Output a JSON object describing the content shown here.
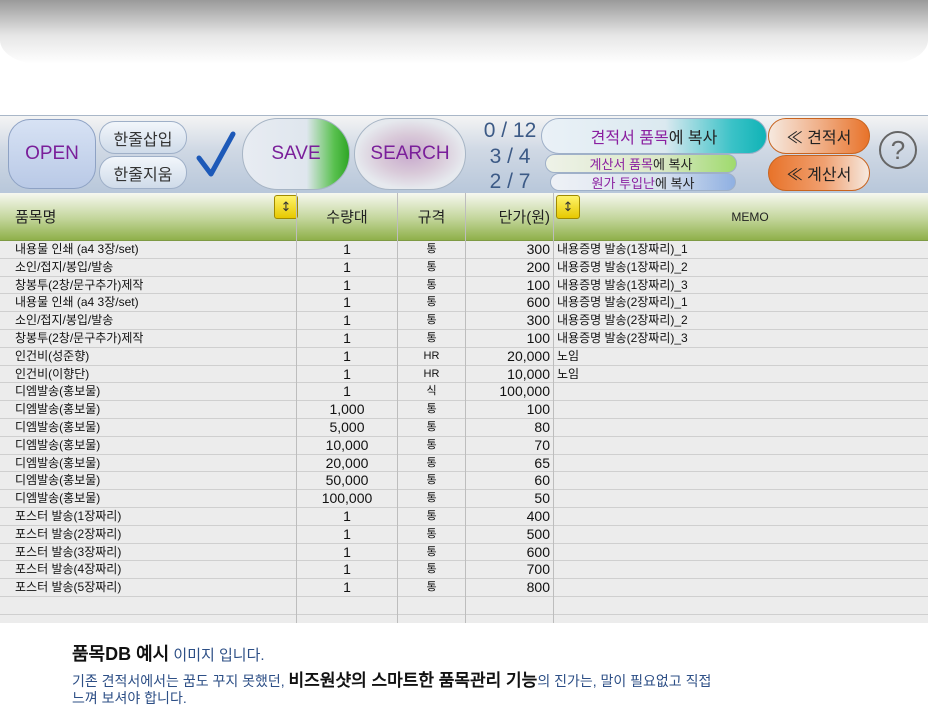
{
  "toolbar": {
    "open": "OPEN",
    "insert_row": "한줄삽입",
    "delete_row": "한줄지움",
    "save": "SAVE",
    "search": "SEARCH",
    "counters": [
      "0 / 12",
      "3 / 4",
      "2 / 7"
    ],
    "copy_quote_items_a": "견적서 품목",
    "copy_quote_items_b": "에 복사",
    "copy_bill_items_a": "계산서 품목",
    "copy_bill_items_b": "에 복사",
    "copy_cost_a": "원가 투입난",
    "copy_cost_b": "에 복사",
    "to_quote": "≪ 견적서",
    "to_bill": "≪ 계산서",
    "help": "?"
  },
  "table": {
    "headers": {
      "name": "품목명",
      "qty": "수량대",
      "unit": "규격",
      "price": "단가(원)",
      "memo": "MEMO",
      "sort": "↕"
    },
    "rows": [
      {
        "name": "내용물 인쇄 (a4 3장/set)",
        "qty": "1",
        "unit": "통",
        "price": "300",
        "memo": "내용증명 발송(1장짜리)_1"
      },
      {
        "name": "소인/접지/봉입/발송",
        "qty": "1",
        "unit": "통",
        "price": "200",
        "memo": "내용증명 발송(1장짜리)_2"
      },
      {
        "name": "창봉투(2창/문구추가)제작",
        "qty": "1",
        "unit": "통",
        "price": "100",
        "memo": "내용증명 발송(1장짜리)_3"
      },
      {
        "name": "내용물 인쇄 (a4 3장/set)",
        "qty": "1",
        "unit": "통",
        "price": "600",
        "memo": "내용증명 발송(2장짜리)_1"
      },
      {
        "name": "소인/접지/봉입/발송",
        "qty": "1",
        "unit": "통",
        "price": "300",
        "memo": "내용증명 발송(2장짜리)_2"
      },
      {
        "name": "창봉투(2창/문구추가)제작",
        "qty": "1",
        "unit": "통",
        "price": "100",
        "memo": "내용증명 발송(2장짜리)_3"
      },
      {
        "name": "인건비(성준향)",
        "qty": "1",
        "unit": "HR",
        "price": "20,000",
        "memo": "노임"
      },
      {
        "name": "인건비(이향단)",
        "qty": "1",
        "unit": "HR",
        "price": "10,000",
        "memo": "노임"
      },
      {
        "name": "디엠발송(홍보물)",
        "qty": "1",
        "unit": "식",
        "price": "100,000",
        "memo": ""
      },
      {
        "name": "디엠발송(홍보물)",
        "qty": "1,000",
        "unit": "통",
        "price": "100",
        "memo": ""
      },
      {
        "name": "디엠발송(홍보물)",
        "qty": "5,000",
        "unit": "통",
        "price": "80",
        "memo": ""
      },
      {
        "name": "디엠발송(홍보물)",
        "qty": "10,000",
        "unit": "통",
        "price": "70",
        "memo": ""
      },
      {
        "name": "디엠발송(홍보물)",
        "qty": "20,000",
        "unit": "통",
        "price": "65",
        "memo": ""
      },
      {
        "name": "디엠발송(홍보물)",
        "qty": "50,000",
        "unit": "통",
        "price": "60",
        "memo": ""
      },
      {
        "name": "디엠발송(홍보물)",
        "qty": "100,000",
        "unit": "통",
        "price": "50",
        "memo": ""
      },
      {
        "name": "포스터 발송(1장짜리)",
        "qty": "1",
        "unit": "통",
        "price": "400",
        "memo": ""
      },
      {
        "name": "포스터 발송(2장짜리)",
        "qty": "1",
        "unit": "통",
        "price": "500",
        "memo": ""
      },
      {
        "name": "포스터 발송(3장짜리)",
        "qty": "1",
        "unit": "통",
        "price": "600",
        "memo": ""
      },
      {
        "name": "포스터 발송(4장짜리)",
        "qty": "1",
        "unit": "통",
        "price": "700",
        "memo": ""
      },
      {
        "name": "포스터 발송(5장짜리)",
        "qty": "1",
        "unit": "통",
        "price": "800",
        "memo": ""
      },
      {
        "name": "",
        "qty": "",
        "unit": "",
        "price": "",
        "memo": ""
      }
    ]
  },
  "caption": {
    "line1_bold": "품목DB  예시",
    "line1_rest": " 이미지 입니다.",
    "line2_a": "기존 견적서에서는  꿈도 꾸지 못했던, ",
    "line2_b": "비즈원샷의 스마트한  품목관리 기능",
    "line2_c": "의  진가는,   말이 필요없고  직접",
    "line3": "느껴 보셔야 합니다."
  },
  "colors": {
    "accent_purple": "#7a1f9a",
    "header_green": "#8fb04a",
    "text_blue": "#2d4f86"
  }
}
